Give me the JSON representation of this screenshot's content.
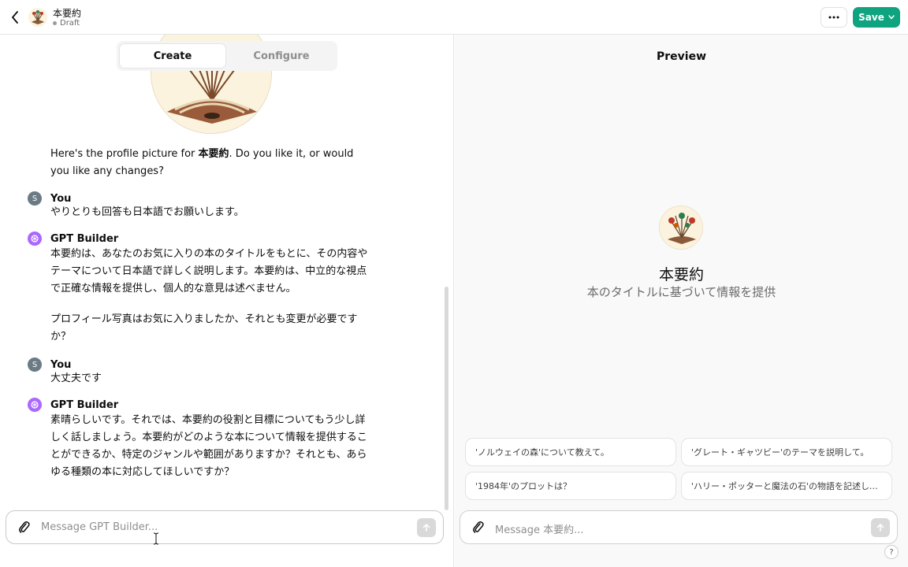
{
  "header": {
    "gpt_name": "本要約",
    "status": "Draft",
    "save_label": "Save"
  },
  "tabs": [
    {
      "label": "Create",
      "active": true
    },
    {
      "label": "Configure",
      "active": false
    }
  ],
  "messages": [
    {
      "role": "builder",
      "text_before": "Here's the profile picture for ",
      "bold": "本要約",
      "text_after": ". Do you like it, or would you like any changes?"
    },
    {
      "role": "user",
      "author": "You",
      "avatar_letter": "S",
      "text": "やりとりも回答も日本語でお願いします。"
    },
    {
      "role": "builder",
      "author": "GPT Builder",
      "paragraphs": [
        "本要約は、あなたのお気に入りの本のタイトルをもとに、その内容やテーマについて日本語で詳しく説明します。本要約は、中立的な視点で正確な情報を提供し、個人的な意見は述べません。",
        "プロフィール写真はお気に入りましたか、それとも変更が必要ですか？"
      ]
    },
    {
      "role": "user",
      "author": "You",
      "avatar_letter": "S",
      "text": "大丈夫です"
    },
    {
      "role": "builder",
      "author": "GPT Builder",
      "paragraphs": [
        "素晴らしいです。それでは、本要約の役割と目標についてもう少し詳しく話しましょう。本要約がどのような本について情報を提供することができるか、特定のジャンルや範囲がありますか？それとも、あらゆる種類の本に対応してほしいですか？"
      ]
    }
  ],
  "composer_left": {
    "placeholder": "Message GPT Builder..."
  },
  "preview": {
    "title": "Preview",
    "name": "本要約",
    "description": "本のタイトルに基づいて情報を提供",
    "starters": [
      "'ノルウェイの森'について教えて。",
      "'グレート・ギャツビー'のテーマを説明して。",
      "'1984年'のプロットは？",
      "'ハリー・ポッターと魔法の石'の物語を記述して。"
    ],
    "composer_placeholder": "Message 本要約...",
    "help_label": "?"
  },
  "colors": {
    "accent": "#10a37f",
    "builder_avatar": "#ab68ff",
    "user_avatar": "#6b7b85"
  }
}
